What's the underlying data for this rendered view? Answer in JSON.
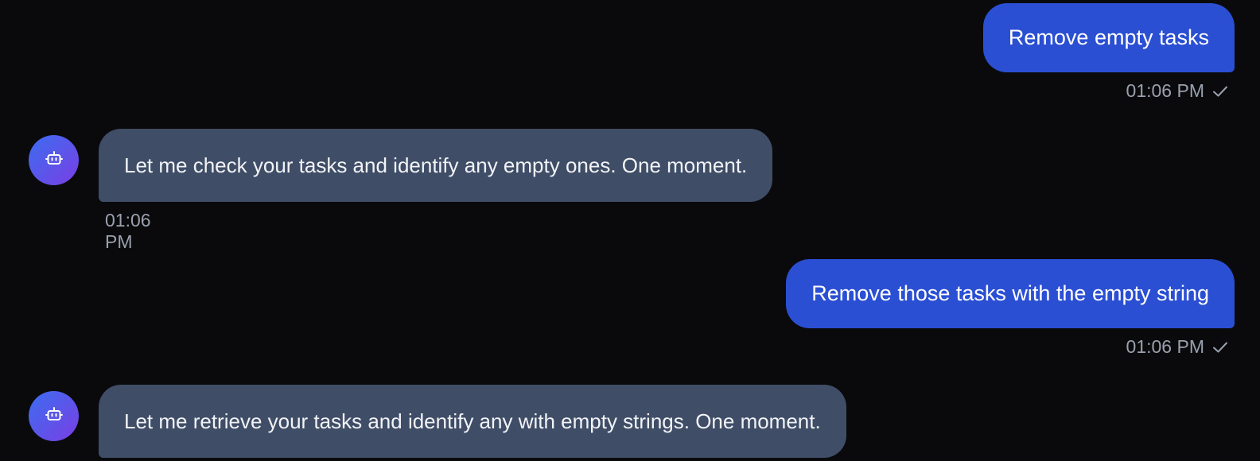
{
  "messages": [
    {
      "role": "user",
      "text": "Remove empty tasks",
      "time": "01:06 PM",
      "status_icon": "check-icon"
    },
    {
      "role": "assistant",
      "text": "Let me check your tasks and identify any empty ones. One moment.",
      "time": "01:06 PM",
      "avatar_icon": "bot-icon"
    },
    {
      "role": "user",
      "text": "Remove those tasks with the empty string",
      "time": "01:06 PM",
      "status_icon": "check-icon"
    },
    {
      "role": "assistant",
      "text": "Let me retrieve your tasks and identify any with empty strings. One moment.",
      "avatar_icon": "bot-icon"
    }
  ],
  "colors": {
    "background": "#0a0a0d",
    "user_bubble": "#2b4fd3",
    "assistant_bubble": "#3f4d66",
    "timestamp": "#9aa1ad",
    "avatar_gradient_start": "#3b6df0",
    "avatar_gradient_end": "#7a3fe4"
  }
}
